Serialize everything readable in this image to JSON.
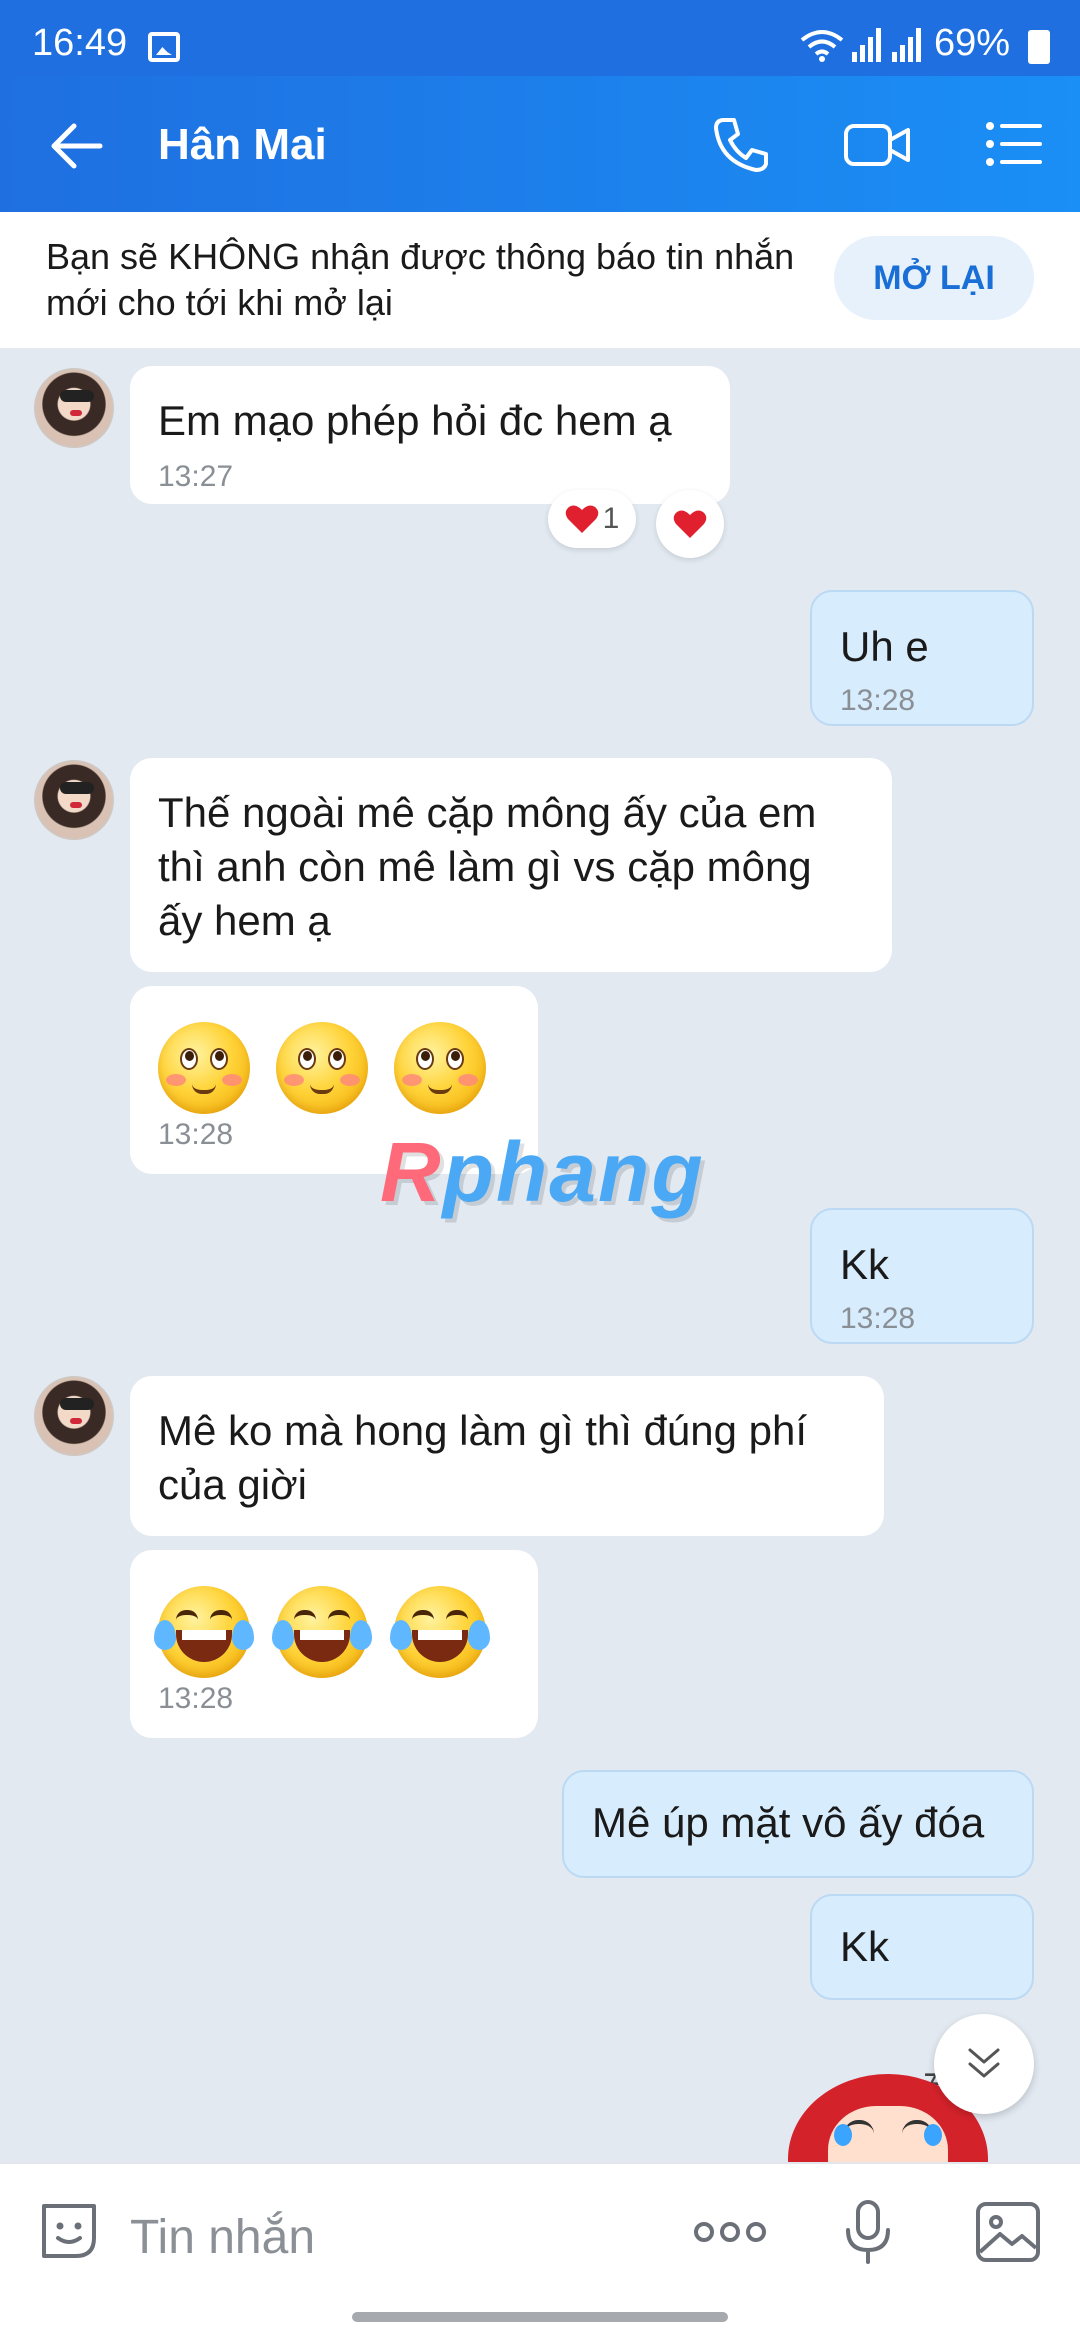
{
  "status_bar": {
    "time": "16:49",
    "battery": "69%"
  },
  "header": {
    "title": "Hân Mai"
  },
  "notice": {
    "text": "Bạn sẽ KHÔNG nhận được thông báo tin nhắn mới cho tới khi mở lại",
    "button": "MỞ LẠI"
  },
  "messages": [
    {
      "from": "them",
      "text": "Em mạo phép hỏi đc hem ạ",
      "time": "13:27",
      "reaction_count": "1"
    },
    {
      "from": "me",
      "text": "Uh e",
      "time": "13:28"
    },
    {
      "from": "them",
      "text": "Thế ngoài mê cặp mông ấy của em thì anh còn mê làm gì vs cặp mông ấy hem ạ"
    },
    {
      "from": "them",
      "emoji": "rolling-eyes-face",
      "time": "13:28"
    },
    {
      "from": "me",
      "text": "Kk",
      "time": "13:28"
    },
    {
      "from": "them",
      "text": "Mê ko mà hong làm gì thì đúng phí của giời"
    },
    {
      "from": "them",
      "emoji": "tears-of-joy-face",
      "time": "13:28"
    },
    {
      "from": "me",
      "text": "Mê úp mặt vô ấy đóa"
    },
    {
      "from": "me",
      "text": "Kk"
    }
  ],
  "watermark": {
    "text": "Rphang"
  },
  "input": {
    "placeholder": "Tin nhắn"
  },
  "colors": {
    "header": "#1f6fe0",
    "my_bubble": "#d7ecfc",
    "background": "#e2e9f1",
    "accent": "#1a6fd6"
  }
}
